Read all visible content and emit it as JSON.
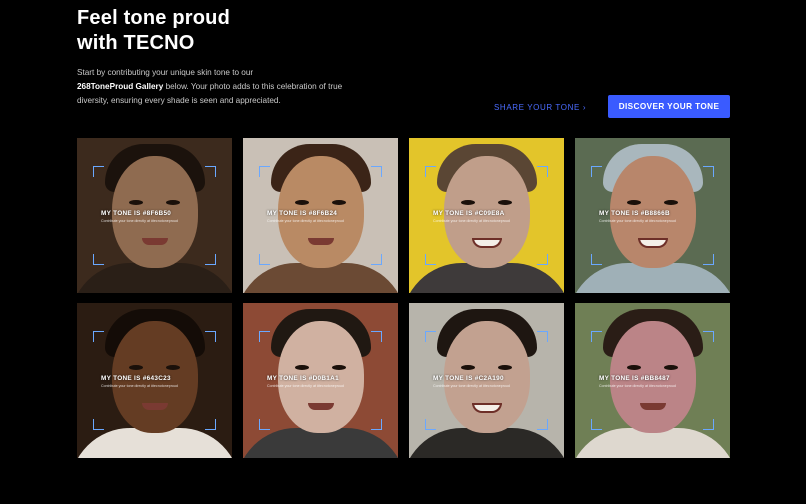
{
  "header": {
    "headline_line1": "Feel tone proud",
    "headline_line2": "with TECNO",
    "intro_before": "Start by contributing your unique skin tone to our",
    "intro_bold": "268ToneProud Gallery",
    "intro_after": "below. Your photo adds to this celebration of true diversity, ensuring every shade is seen and appreciated."
  },
  "actions": {
    "share_label": "SHARE YOUR TONE",
    "share_chevron": "›",
    "discover_label": "DISCOVER YOUR TONE"
  },
  "colors": {
    "background": "#000000",
    "accent": "#3a5bff",
    "link": "#4b6cff",
    "frame_corner": "#6aa8ff"
  },
  "gallery": {
    "cards": [
      {
        "label": "MY TONE IS #8F6B50",
        "caption": "Contribute your tone directly at #tecnotoneproud",
        "bg": "#3c2a1d",
        "skin": "#8f6b50",
        "hair": "#1b120c",
        "clothes": "#2a1f17",
        "smile": false
      },
      {
        "label": "MY TONE IS #8F6B24",
        "caption": "Contribute your tone directly at #tecnotoneproud",
        "bg": "#c9c0b6",
        "skin": "#b98a64",
        "hair": "#3b2417",
        "clothes": "#6b4a34",
        "smile": false
      },
      {
        "label": "MY TONE IS #C09E8A",
        "caption": "Contribute your tone directly at #tecnotoneproud",
        "bg": "#e3c52a",
        "skin": "#c09e8a",
        "hair": "#5a4634",
        "clothes": "#3e3a3a",
        "smile": true
      },
      {
        "label": "MY TONE IS #B8866B",
        "caption": "Contribute your tone directly at #tecnotoneproud",
        "bg": "#5b6b52",
        "skin": "#b8866b",
        "hair": "#a9b7bd",
        "clothes": "#9fb0b7",
        "smile": true
      },
      {
        "label": "MY TONE IS #643C23",
        "caption": "Contribute your tone directly at #tecnotoneproud",
        "bg": "#2b1c12",
        "skin": "#643c23",
        "hair": "#140c07",
        "clothes": "#e6e0d8",
        "smile": false
      },
      {
        "label": "MY TONE IS #D0B1A1",
        "caption": "Contribute your tone directly at #tecnotoneproud",
        "bg": "#8d4a35",
        "skin": "#d0b1a1",
        "hair": "#201812",
        "clothes": "#3a3a3a",
        "smile": false
      },
      {
        "label": "MY TONE IS #C2A190",
        "caption": "Contribute your tone directly at #tecnotoneproud",
        "bg": "#b7b4ab",
        "skin": "#c2a190",
        "hair": "#1e1611",
        "clothes": "#2b2926",
        "smile": true
      },
      {
        "label": "MY TONE IS #BB8487",
        "caption": "Contribute your tone directly at #tecnotoneproud",
        "bg": "#6f7f55",
        "skin": "#bb8487",
        "hair": "#2a1d16",
        "clothes": "#ded8cf",
        "smile": false
      }
    ]
  }
}
